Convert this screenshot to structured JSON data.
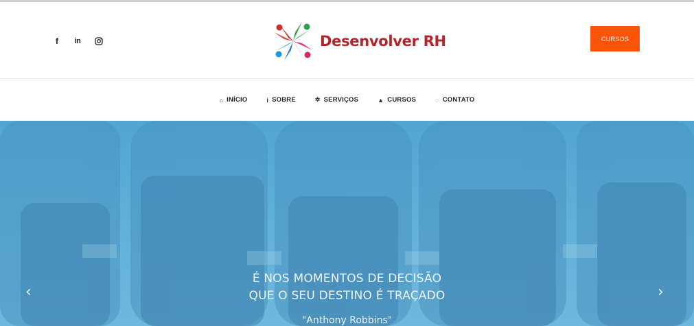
{
  "social": {
    "facebook_icon": "f",
    "linkedin_icon": "in"
  },
  "brand": {
    "name": "Desenvolver RH"
  },
  "cta": {
    "label": "CURSOS"
  },
  "nav": {
    "items": [
      {
        "icon": "home-icon",
        "glyph": "⌂",
        "label": "INÍCIO"
      },
      {
        "icon": "info-icon",
        "glyph": "i",
        "label": "SOBRE"
      },
      {
        "icon": "gear-icon",
        "glyph": "✲",
        "label": "SERVIÇOS"
      },
      {
        "icon": "graduation-cap-icon",
        "glyph": "▲",
        "label": "CURSOS"
      },
      {
        "icon": "chat-icon",
        "glyph": "◌",
        "label": "CONTATO"
      }
    ]
  },
  "hero": {
    "line1": "É NOS MOMENTOS DE DECISÃO",
    "line2": "QUE O SEU DESTINO É TRAÇADO",
    "author": "\"Anthony Robbins\"",
    "prev_glyph": "‹",
    "next_glyph": "›"
  },
  "colors": {
    "accent": "#fa5408",
    "brand": "#b3252b",
    "hero_tint": "#5fb0d8"
  }
}
